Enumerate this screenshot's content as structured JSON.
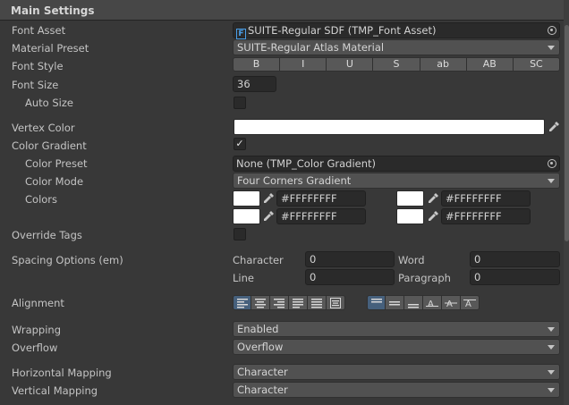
{
  "header": {
    "title": "Main Settings"
  },
  "font_asset": {
    "label": "Font Asset",
    "value": "SUITE-Regular SDF (TMP_Font Asset)",
    "icon": "font-asset-icon"
  },
  "material_preset": {
    "label": "Material Preset",
    "value": "SUITE-Regular Atlas Material"
  },
  "font_style": {
    "label": "Font Style",
    "buttons": [
      "B",
      "I",
      "U",
      "S",
      "ab",
      "AB",
      "SC"
    ]
  },
  "font_size": {
    "label": "Font Size",
    "value": "36"
  },
  "auto_size": {
    "label": "Auto Size",
    "checked": false
  },
  "vertex_color": {
    "label": "Vertex Color",
    "color": "#FFFFFF"
  },
  "color_gradient": {
    "label": "Color Gradient",
    "checked": true
  },
  "color_preset": {
    "label": "Color Preset",
    "value": "None (TMP_Color Gradient)"
  },
  "color_mode": {
    "label": "Color Mode",
    "value": "Four Corners Gradient"
  },
  "colors": {
    "label": "Colors",
    "top_left": "#FFFFFFFF",
    "top_right": "#FFFFFFFF",
    "bottom_left": "#FFFFFFFF",
    "bottom_right": "#FFFFFFFF"
  },
  "override_tags": {
    "label": "Override Tags",
    "checked": false
  },
  "spacing": {
    "label": "Spacing Options (em)",
    "character_label": "Character",
    "character": "0",
    "word_label": "Word",
    "word": "0",
    "line_label": "Line",
    "line": "0",
    "paragraph_label": "Paragraph",
    "paragraph": "0"
  },
  "alignment": {
    "label": "Alignment",
    "horizontal": [
      "align-left",
      "align-center",
      "align-right",
      "align-justified",
      "align-flush",
      "align-geometry-center"
    ],
    "horizontal_selected": "align-left",
    "vertical": [
      "align-top",
      "align-middle",
      "align-bottom",
      "align-baseline",
      "align-midline",
      "align-capline"
    ],
    "vertical_selected": "align-top"
  },
  "wrapping": {
    "label": "Wrapping",
    "value": "Enabled"
  },
  "overflow": {
    "label": "Overflow",
    "value": "Overflow"
  },
  "horizontal_mapping": {
    "label": "Horizontal Mapping",
    "value": "Character"
  },
  "vertical_mapping": {
    "label": "Vertical Mapping",
    "value": "Character"
  },
  "colors_theme": {
    "background": "#383838",
    "field": "#2a2a2a",
    "accent": "#46607c",
    "text": "#c4c4c4"
  }
}
